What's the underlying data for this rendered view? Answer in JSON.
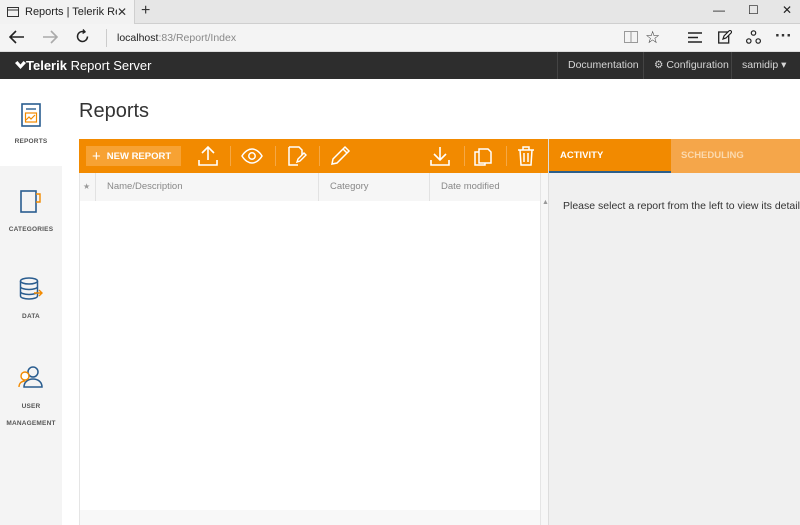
{
  "browser": {
    "tab_title": "Reports | Telerik Report S",
    "tab_close": "✕",
    "new_tab": "+",
    "window_controls": [
      "—",
      "☐",
      "✕"
    ],
    "address_host": "localhost",
    "address_path": ":83/Report/Index",
    "icons": [
      "back-icon",
      "forward-icon",
      "refresh-icon",
      "reading-view-icon",
      "favorite-star-icon",
      "hub-icon",
      "web-note-icon",
      "share-icon",
      "more-icon"
    ]
  },
  "app": {
    "brand_bold": "Telerik",
    "brand_rest": " Report Server",
    "header_links": {
      "documentation": "Documentation",
      "configuration": "⚙ Configuration",
      "user": "samidip ▾"
    },
    "colors": {
      "accent": "#f28a00",
      "header_bg": "#2d2d2d"
    }
  },
  "sidenav": {
    "items": [
      {
        "label": "REPORTS",
        "icon": "report-icon",
        "active": true
      },
      {
        "label": "CATEGORIES",
        "icon": "categories-icon"
      },
      {
        "label": "DATA",
        "icon": "database-icon"
      },
      {
        "label": "USER",
        "label2": "MANAGEMENT",
        "icon": "users-icon"
      }
    ]
  },
  "main": {
    "title": "Reports",
    "toolbar": {
      "new_report": "NEW REPORT",
      "icons": [
        "upload-icon",
        "preview-eye-icon",
        "design-report-icon",
        "edit-pencil-icon",
        "download-icon",
        "clone-icon",
        "delete-trash-icon"
      ]
    },
    "grid": {
      "star_col": "★",
      "columns": [
        "Name/Description",
        "Category",
        "Date modified"
      ],
      "scroll_up": "▲"
    }
  },
  "panel": {
    "tabs": [
      "ACTIVITY",
      "SCHEDULING"
    ],
    "placeholder": "Please select a report from the left to view its details"
  }
}
